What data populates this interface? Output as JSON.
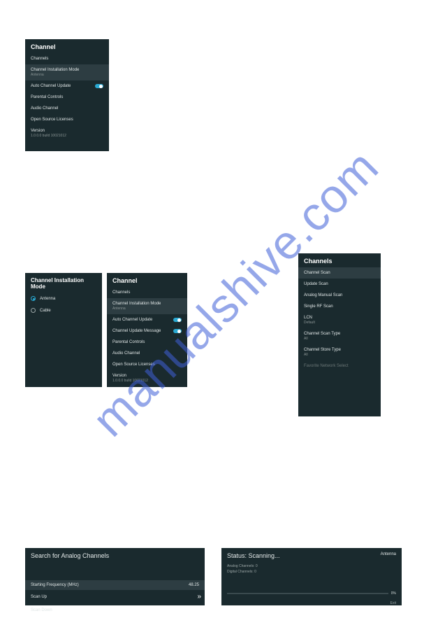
{
  "watermark": "manualshive.com",
  "panel1": {
    "title": "Channel",
    "channels_label": "Channels",
    "install_mode_label": "Channel Installation Mode",
    "install_mode_value": "Antenna",
    "auto_update_label": "Auto Channel Update",
    "parental_label": "Parental Controls",
    "audio_channel_label": "Audio Channel",
    "open_source_label": "Open Source Licenses",
    "version_label": "Version",
    "version_value": "1.0.0.0 build 10021012"
  },
  "panel2": {
    "title": "Channel Installation Mode",
    "antenna_label": "Antenna",
    "cable_label": "Cable"
  },
  "panel3": {
    "title": "Channel",
    "channels_label": "Channels",
    "install_mode_label": "Channel Installation Mode",
    "install_mode_value": "Antenna",
    "auto_update_label": "Auto Channel Update",
    "update_message_label": "Channel Update Message",
    "parental_label": "Parental Controls",
    "audio_channel_label": "Audio Channel",
    "open_source_label": "Open Source Licenses",
    "version_label": "Version",
    "version_value": "1.0.0.0 build 10021012"
  },
  "panel4": {
    "title": "Channels",
    "channel_scan_label": "Channel Scan",
    "update_scan_label": "Update Scan",
    "analog_manual_label": "Analog Manual Scan",
    "single_rf_label": "Single RF Scan",
    "lcn_label": "LCN",
    "lcn_value": "Default",
    "scan_type_label": "Channel Scan Type",
    "scan_type_value": "All",
    "store_type_label": "Channel Store Type",
    "store_type_value": "All",
    "favorite_label": "Favorite Network Select"
  },
  "panel5": {
    "title": "Search for Analog Channels",
    "freq_label": "Starting Frequency (MHz)",
    "freq_value": "48.25",
    "scan_up_label": "Scan Up",
    "scan_down_label": "Scan Down"
  },
  "panel6": {
    "title": "Status: Scanning...",
    "mode_label": "Antenna",
    "analog_label": "Analog Channels: 0",
    "digital_label": "Digital Channels: 0",
    "progress_pct": "0%",
    "exit_label": "Exit"
  }
}
